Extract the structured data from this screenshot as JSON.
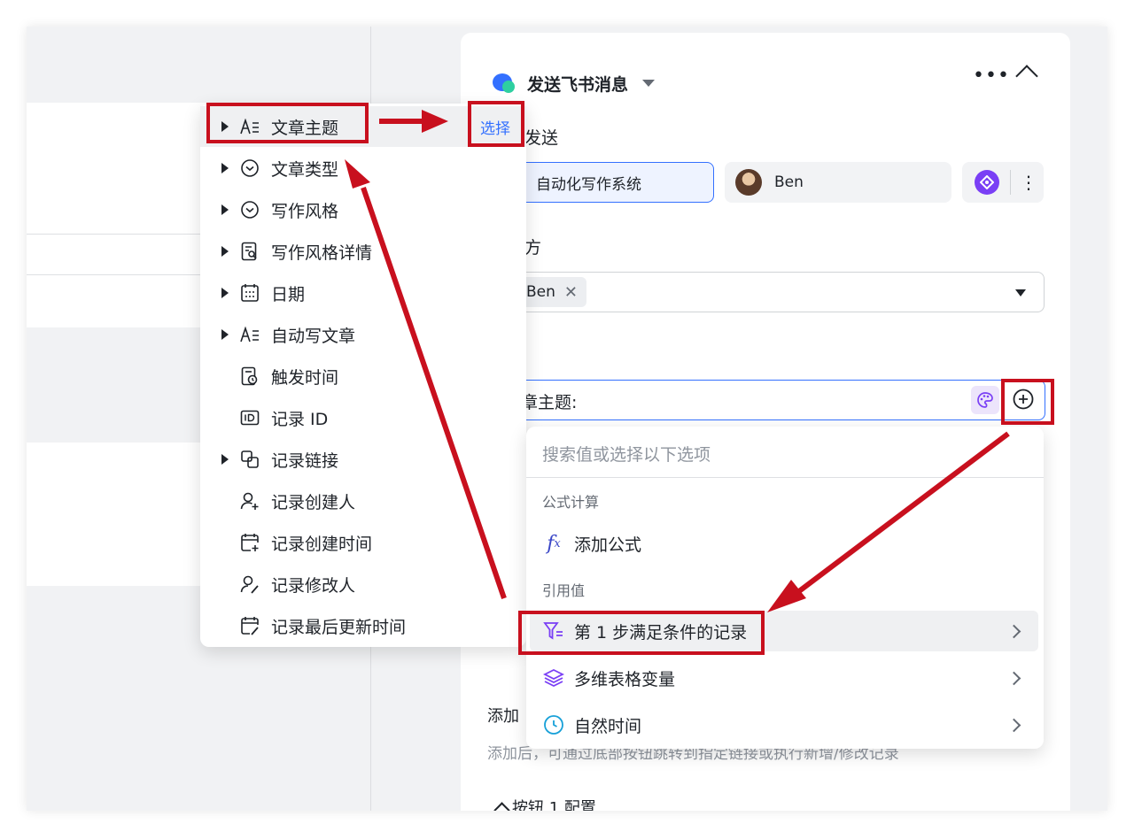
{
  "panel": {
    "title": "发送飞书消息",
    "send_label": "发送",
    "source_selected": "自动化写作系统",
    "user_name": "Ben",
    "receiver_label": "方",
    "receiver_chip": "Ben",
    "content_text": "章主题:",
    "add_button_label": "添加",
    "add_button_desc": "添加后，可通过底部按钮跳转到指定链接或执行新增/修改记录",
    "button_config": "按钮 1 配置"
  },
  "field_menu": {
    "select_label": "选择",
    "items": [
      {
        "label": "文章主题",
        "icon": "text-icon",
        "expandable": true
      },
      {
        "label": "文章类型",
        "icon": "single-select-icon",
        "expandable": true
      },
      {
        "label": "写作风格",
        "icon": "single-select-icon",
        "expandable": true
      },
      {
        "label": "写作风格详情",
        "icon": "lookup-icon",
        "expandable": true
      },
      {
        "label": "日期",
        "icon": "calendar-icon",
        "expandable": true
      },
      {
        "label": "自动写文章",
        "icon": "text-icon",
        "expandable": true
      },
      {
        "label": "触发时间",
        "icon": "time-doc-icon",
        "expandable": false
      },
      {
        "label": "记录 ID",
        "icon": "id-icon",
        "expandable": false
      },
      {
        "label": "记录链接",
        "icon": "link-icon",
        "expandable": true
      },
      {
        "label": "记录创建人",
        "icon": "user-add-icon",
        "expandable": false
      },
      {
        "label": "记录创建时间",
        "icon": "calendar-add-icon",
        "expandable": false
      },
      {
        "label": "记录修改人",
        "icon": "user-edit-icon",
        "expandable": false
      },
      {
        "label": "记录最后更新时间",
        "icon": "calendar-edit-icon",
        "expandable": false
      }
    ]
  },
  "ref_menu": {
    "search_placeholder": "搜索值或选择以下选项",
    "formula_group": "公式计算",
    "add_formula": "添加公式",
    "ref_group": "引用值",
    "items": [
      {
        "label": "第 1 步满足条件的记录",
        "icon": "filter-icon"
      },
      {
        "label": "多维表格变量",
        "icon": "layers-icon"
      },
      {
        "label": "自然时间",
        "icon": "clock-icon"
      }
    ]
  },
  "colors": {
    "accent": "#3370ff",
    "annotation": "#c8101e",
    "purple": "#7a3ff5"
  }
}
